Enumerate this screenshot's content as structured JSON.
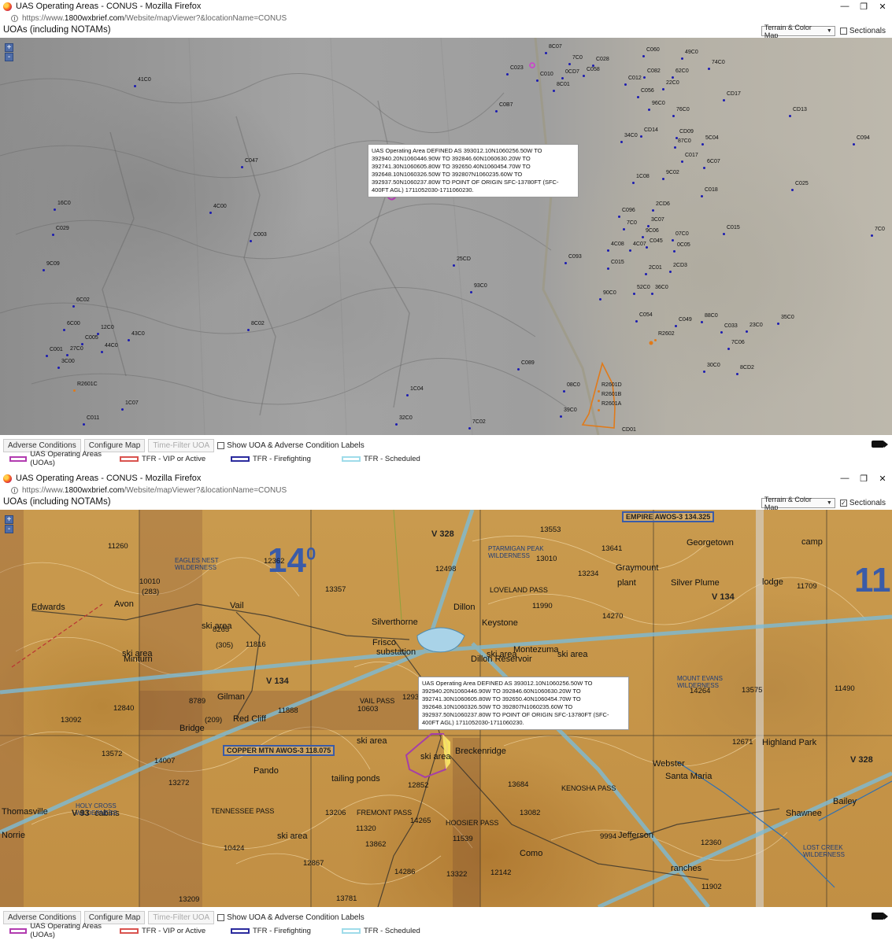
{
  "window1": {
    "title": "UAS Operating Areas - CONUS - Mozilla Firefox",
    "url_prefix": "https://www.",
    "url_domain": "1800wxbrief.com",
    "url_path": "/Website/mapViewer?&locationName=CONUS",
    "app_title": "UOAs (including NOTAMs)",
    "map_type": "Terrain & Color Map",
    "sectionals_label": "Sectionals",
    "sectionals_checked": false,
    "zoom_in": "+",
    "zoom_out": "-",
    "popup_text": "UAS Operating Area DEFINED AS 393012.10N1060256.50W TO 392940.20N1060446.90W TO 392846.60N1060630.20W TO 392741.30N1060605.80W TO 392650.40N1060454.70W TO 392648.10N1060326.50W TO 392807N1060235.60W TO 392937.50N1060237.80W TO POINT OF ORIGIN SFC-13780FT (SFC-400FT AGL) 1711052030-1711060230.",
    "labels": [
      "8C07",
      "C023",
      "7C0",
      "C010",
      "0CD7",
      "C028",
      "C058",
      "C060",
      "C082",
      "49C0",
      "62C0",
      "74C0",
      "8C01",
      "C012",
      "C056",
      "22C0",
      "41C0",
      "CD17",
      "C0B7",
      "96C0",
      "76C0",
      "CD13",
      "34C0",
      "CD14",
      "CD09",
      "87C0",
      "5C04",
      "C094",
      "C017",
      "9C02",
      "6C07",
      "C047",
      "1C08",
      "C025",
      "C018",
      "16C0",
      "4C00",
      "2CD6",
      "C096",
      "3C07",
      "C029",
      "7C0",
      "C015",
      "C003",
      "9C06",
      "07C0",
      "C045",
      "4C08",
      "4C07",
      "0C05",
      "7C0",
      "9C09",
      "C093",
      "25CD",
      "C015",
      "2C01",
      "2CD3",
      "93C0",
      "90C0",
      "52C0",
      "36C0",
      "6C02",
      "C054",
      "C049",
      "88C0",
      "35C0",
      "8C02",
      "C033",
      "23C0",
      "12C0",
      "6C00",
      "43C0",
      "C005",
      "44C0",
      "R2602",
      "C001",
      "7C06",
      "27C0",
      "3C00",
      "C089",
      "30C0",
      "8CD2",
      "08C0",
      "R2601D",
      "R2601B",
      "R2601A",
      "R2601C",
      "1C04",
      "1C07",
      "39C0",
      "32C0",
      "C011",
      "7C02",
      "CD01",
      "7C08"
    ],
    "buttons": [
      "Adverse Conditions",
      "Configure Map",
      "Time-Filter UOA"
    ],
    "show_labels": "Show UOA & Adverse Condition Labels",
    "legend": [
      "UAS Operating Areas (UOAs)",
      "TFR - VIP or Active",
      "TFR - Firefighting",
      "TFR - Scheduled"
    ]
  },
  "window2": {
    "title": "UAS Operating Areas - CONUS - Mozilla Firefox",
    "url_prefix": "https://www.",
    "url_domain": "1800wxbrief.com",
    "url_path": "/Website/mapViewer?&locationName=CONUS",
    "app_title": "UOAs (including NOTAMs)",
    "map_type": "Terrain & Color Map",
    "sectionals_label": "Sectionals",
    "sectionals_checked": true,
    "zoom_in": "+",
    "zoom_out": "-",
    "popup_text": "UAS Operating Area DEFINED AS 393012.10N1060256.50W TO 392940.20N1060446.90W TO 392846.60N1060630.20W TO 392741.30N1060605.80W TO 392650.40N1060454.70W TO 392648.10N1060326.50W TO 392807N1060235.60W TO 392937.50N1060237.80W TO POINT OF ORIGIN SFC-13780FT (SFC-400FT AGL) 1711052030-1711060230.",
    "place_names": [
      "Edwards",
      "Avon",
      "Vail",
      "Minturn",
      "Gilman",
      "Red Cliff",
      "Silverthorne",
      "Dillon",
      "Keystone",
      "Frisco",
      "substation",
      "Montezuma",
      "Georgetown",
      "Graymount",
      "Silver Plume",
      "Breckenridge",
      "Pando",
      "Webster",
      "Santa Maria",
      "Highland Park",
      "Shawnee",
      "Bailey",
      "Jefferson",
      "Como",
      "Thomasville",
      "Norrie",
      "lodge",
      "plant",
      "camp",
      "ranches",
      "ski area",
      "ski area",
      "ski area",
      "ski area",
      "ski area",
      "ski area",
      "ski area",
      "tailing ponds",
      "cabins",
      "Bridge",
      "Dillon Reservoir"
    ],
    "passes": [
      "LOVELAND PASS",
      "VAIL PASS",
      "FREMONT PASS",
      "HOOSIER PASS",
      "TENNESSEE PASS",
      "KENOSHA PASS"
    ],
    "wilderness": [
      "EAGLES NEST WILDERNESS",
      "PTARMIGAN PEAK WILDERNESS",
      "MOUNT EVANS WILDERNESS",
      "HOLY CROSS WILDERNESS",
      "LOST CREEK WILDERNESS"
    ],
    "elevations": [
      "11260",
      "12362",
      "13357",
      "12498",
      "13010",
      "13234",
      "13641",
      "14270",
      "11990",
      "11816",
      "8265",
      "(305)",
      "10010",
      "(283)",
      "10603",
      "12932",
      "11888",
      "12840",
      "13092",
      "8789",
      "(209)",
      "13572",
      "14007",
      "13272",
      "13206",
      "12852",
      "14265",
      "11320",
      "13862",
      "11539",
      "12867",
      "13209",
      "10424",
      "14286",
      "13322",
      "12142",
      "13781",
      "13684",
      "13082",
      "9994",
      "12360",
      "12671",
      "11709",
      "11490",
      "13575",
      "11902",
      "14264",
      "13553"
    ],
    "airways": [
      "V 328",
      "V 134",
      "V 134",
      "V 93",
      "V 328"
    ],
    "awos": [
      "EMPIRE AWOS-3 134.325",
      "COPPER MTN AWOS-3 118.075"
    ],
    "sector_marks": [
      "14",
      "0",
      "11"
    ],
    "buttons": [
      "Adverse Conditions",
      "Configure Map",
      "Time-Filter UOA"
    ],
    "show_labels": "Show UOA & Adverse Condition Labels",
    "legend": [
      "UAS Operating Areas (UOAs)",
      "TFR - VIP or Active",
      "TFR - Firefighting",
      "TFR - Scheduled"
    ]
  },
  "colors": {
    "uoa": "#b23cb0",
    "tfr_vip": "#d9534f",
    "tfr_fire": "#2b2b9e",
    "tfr_sched": "#9fdcea",
    "dot": "#1b1bb0",
    "restricted": "#e07a1a"
  },
  "icons": [
    "firefox-icon",
    "minimize-icon",
    "maximize-icon",
    "close-icon",
    "info-icon",
    "camera-icon"
  ]
}
